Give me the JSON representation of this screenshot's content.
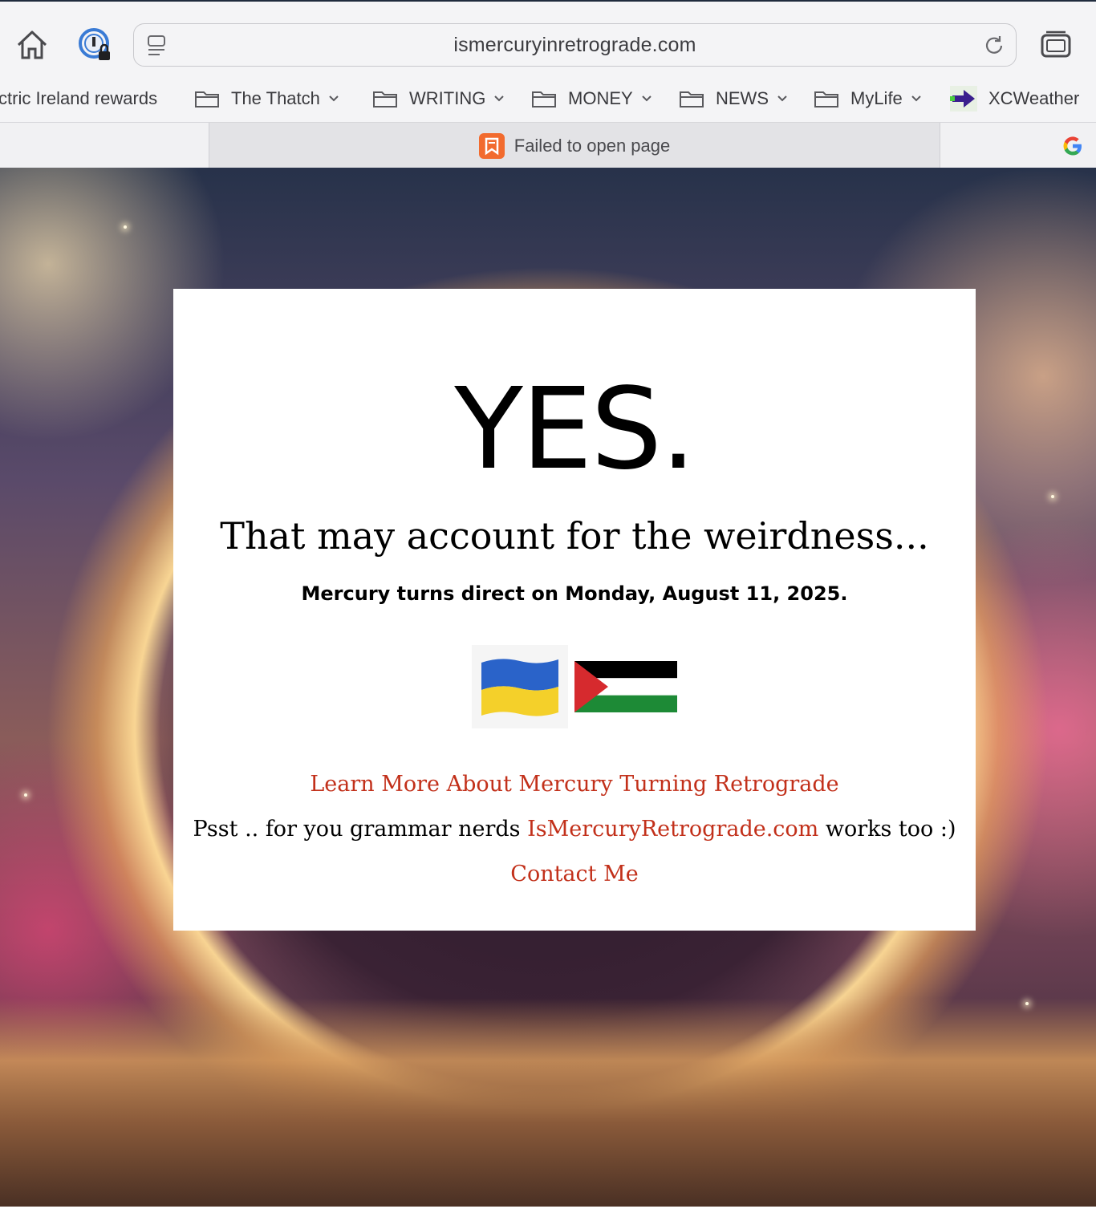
{
  "browser": {
    "url": "ismercuryinretrograde.com",
    "bookmarks": [
      {
        "label": "ctric Ireland rewards"
      },
      {
        "label": "The Thatch"
      },
      {
        "label": "WRITING"
      },
      {
        "label": "MONEY"
      },
      {
        "label": "NEWS"
      },
      {
        "label": "MyLife"
      },
      {
        "label": "XCWeather"
      }
    ],
    "active_tab": {
      "title": "Failed to open page"
    }
  },
  "page": {
    "headline": "YES.",
    "subhead": "That may account for the weirdness...",
    "turns_direct": "Mercury turns direct on Monday, August 11, 2025.",
    "learn_more_link": "Learn More About Mercury Turning Retrograde",
    "psst_prefix": "Psst .. for you grammar nerds ",
    "psst_link": "IsMercuryRetrograde.com",
    "psst_suffix": " works too :)",
    "contact_link": "Contact Me"
  },
  "colors": {
    "link": "#c2301a",
    "ukraine_blue": "#2a63c9",
    "ukraine_yellow": "#f4d02a",
    "palestine_red": "#d62a2e",
    "palestine_green": "#1d8a36"
  }
}
